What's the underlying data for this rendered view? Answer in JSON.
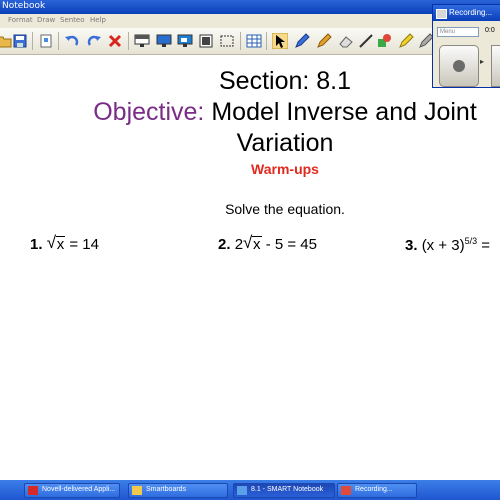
{
  "window": {
    "title": "Notebook"
  },
  "menu": [
    "Format",
    "Draw",
    "Senteo",
    "Help"
  ],
  "toolbar": {
    "icons": [
      "open-icon",
      "save-icon",
      "page-icon",
      "undo-icon",
      "redo-icon",
      "delete-icon",
      "screen-shade-icon",
      "display-icon",
      "capture-icon",
      "image-icon",
      "table-icon",
      "select-arrow-icon",
      "pen-icon",
      "creative-pen-icon",
      "eraser-icon",
      "line-icon",
      "shapes-icon",
      "fill-icon"
    ]
  },
  "slide": {
    "section": "Section: 8.1",
    "objective_label": "Objective:",
    "objective_text": "Model Inverse and Joint",
    "objective_text2": "Variation",
    "warmups": "Warm-ups",
    "instruction": "Solve the equation.",
    "problems": [
      {
        "num": "1.",
        "coef": "",
        "radicand": "x",
        "rest": " = 14"
      },
      {
        "num": "2.",
        "coef": "2",
        "radicand": "x",
        "rest": " - 5 = 45"
      },
      {
        "num": "3.",
        "base": "(x + 3)",
        "exp": "5/3",
        "rest": " ="
      }
    ]
  },
  "recorder": {
    "title": "Recording...",
    "menu_label": "Menu",
    "timer": "0:0",
    "controls": [
      "record-button",
      "options-arrow",
      "stop-button"
    ]
  },
  "taskbar": {
    "items": [
      {
        "label": "Novell-delivered Appli...",
        "active": false
      },
      {
        "label": "Smartboards",
        "active": false
      },
      {
        "label": "8.1 - SMART Notebook",
        "active": true
      },
      {
        "label": "Recording...",
        "active": false
      }
    ]
  },
  "colors": {
    "objective": "#7a2d86",
    "warmups": "#e02a1e",
    "titlebar": "#0a3fb8",
    "taskbar": "#2a62dc"
  }
}
